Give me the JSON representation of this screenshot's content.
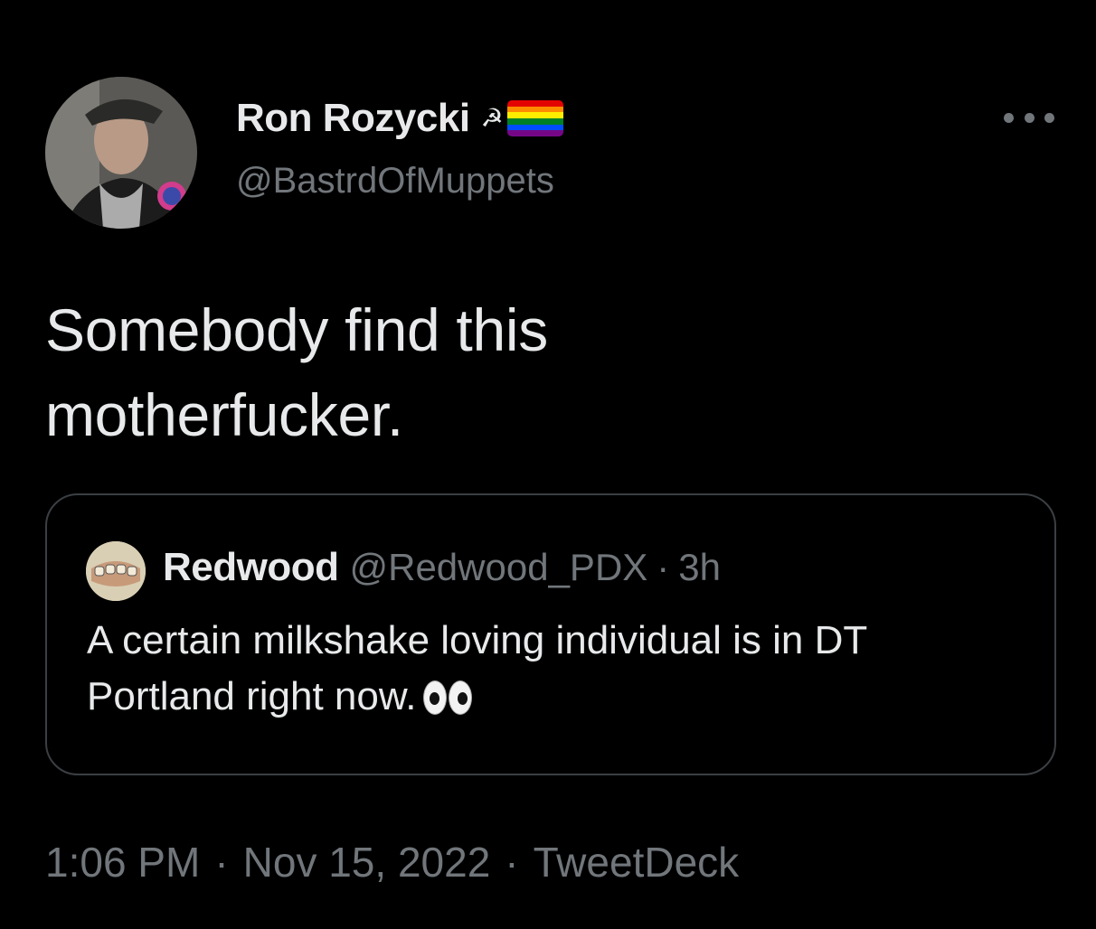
{
  "tweet": {
    "author": {
      "display_name": "Ron Rozycki",
      "name_emojis": [
        "hammer-and-sickle-icon",
        "rainbow-flag-icon"
      ],
      "hammer_glyph": "☭",
      "handle": "@BastrdOfMuppets",
      "avatar": "user-avatar"
    },
    "more_icon": "more-options-icon",
    "text_line1": "Somebody find this",
    "text_line2": "motherfucker.",
    "quoted": {
      "display_name": "Redwood",
      "handle": "@Redwood_PDX",
      "separator": "·",
      "time": "3h",
      "text_line1": "A certain milkshake loving individual is in DT",
      "text_line2": "Portland right now.",
      "emoji": "eyes-emoji",
      "avatar": "quoted-user-avatar"
    },
    "meta": {
      "time": "1:06 PM",
      "date": "Nov 15, 2022",
      "source": "TweetDeck",
      "separator": "·"
    }
  },
  "colors": {
    "background": "#000000",
    "primary_text": "#e7e9ea",
    "secondary_text": "#71767b",
    "card_border": "#3b3f43",
    "flag_stripes": [
      "#e40303",
      "#ff8c00",
      "#ffed00",
      "#008026",
      "#004dff",
      "#750787"
    ]
  }
}
